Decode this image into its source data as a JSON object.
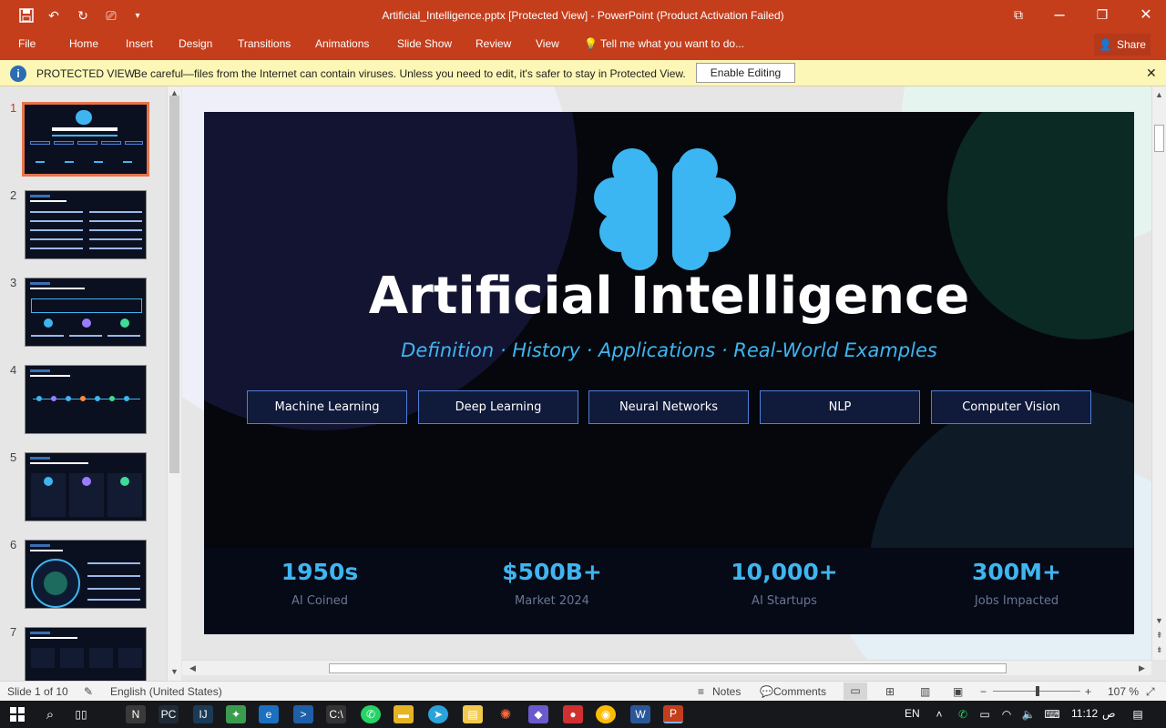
{
  "window": {
    "title": "Artificial_Intelligence.pptx [Protected View] - PowerPoint (Product Activation Failed)",
    "quick_access": [
      "save-icon",
      "undo-icon",
      "redo-icon",
      "present-from-start-icon",
      "customize-icon"
    ],
    "controls": {
      "ribbon_display": "⧉",
      "restore": "❐",
      "close": "✕"
    }
  },
  "ribbon": {
    "tabs": [
      "File",
      "Home",
      "Insert",
      "Design",
      "Transitions",
      "Animations",
      "Slide Show",
      "Review",
      "View"
    ],
    "tell_me": "Tell me what you want to do...",
    "share": "Share"
  },
  "protected_view": {
    "label": "PROTECTED VIEW",
    "message": "Be careful—files from the Internet can contain viruses. Unless you need to edit, it's safer to stay in Protected View.",
    "button": "Enable Editing"
  },
  "thumbnails": [
    {
      "number": "1",
      "selected": true
    },
    {
      "number": "2",
      "selected": false
    },
    {
      "number": "3",
      "selected": false
    },
    {
      "number": "4",
      "selected": false
    },
    {
      "number": "5",
      "selected": false
    },
    {
      "number": "6",
      "selected": false
    },
    {
      "number": "7",
      "selected": false
    }
  ],
  "slide": {
    "title": "Artificial Intelligence",
    "subtitle": "Definition  ·  History  ·  Applications  ·  Real-World Examples",
    "tags": [
      "Machine Learning",
      "Deep Learning",
      "Neural Networks",
      "NLP",
      "Computer Vision"
    ],
    "stats": [
      {
        "value": "1950s",
        "label": "AI Coined"
      },
      {
        "value": "$500B+",
        "label": "Market 2024"
      },
      {
        "value": "10,000+",
        "label": "AI Startups"
      },
      {
        "value": "300M+",
        "label": "Jobs Impacted"
      }
    ],
    "colors": {
      "accent": "#3fb5f0",
      "background": "#05070d",
      "tag_border": "#4d7fd6"
    }
  },
  "status_bar": {
    "slide_info": "Slide 1 of 10",
    "language": "English (United States)",
    "notes": "Notes",
    "comments": "Comments",
    "zoom": "107 %"
  },
  "taskbar": {
    "language": "EN",
    "time": "11:12",
    "am_pm": "ص"
  }
}
